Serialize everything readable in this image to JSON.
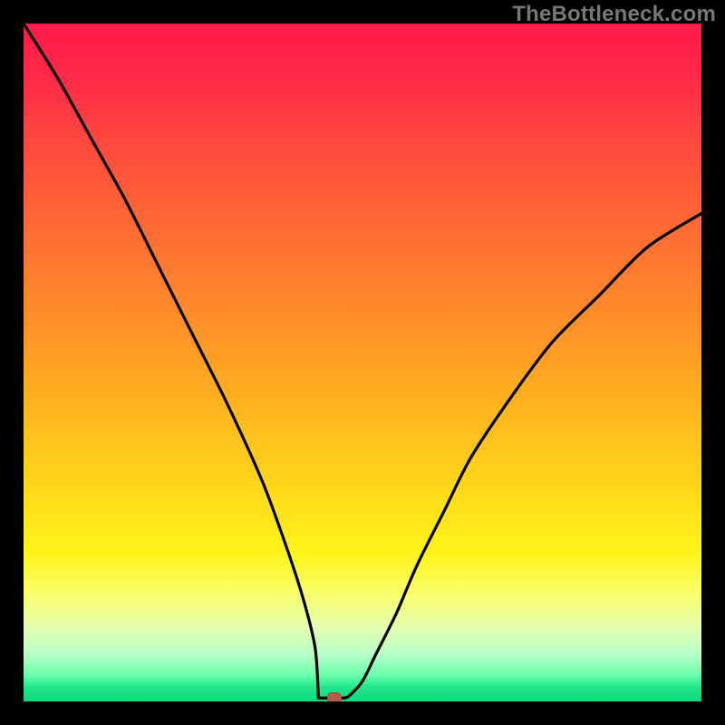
{
  "watermark": "TheBottleneck.com",
  "colors": {
    "top": "#ff1a4b",
    "bottom": "#14d47a",
    "curve": "#000000",
    "marker": "#b85a4a",
    "frame": "#000000"
  },
  "chart_data": {
    "type": "line",
    "title": "",
    "xlabel": "",
    "ylabel": "",
    "xlim": [
      0,
      100
    ],
    "ylim": [
      0,
      100
    ],
    "grid": false,
    "series": [
      {
        "name": "bottleneck-curve",
        "x": [
          0,
          5,
          10,
          15,
          20,
          25,
          30,
          35,
          38,
          41,
          43,
          44,
          45,
          46,
          48,
          50,
          52,
          55,
          58,
          62,
          66,
          72,
          78,
          85,
          92,
          100
        ],
        "y": [
          100,
          92,
          83,
          74,
          64,
          54,
          44,
          33,
          25,
          16,
          8,
          3,
          0.5,
          0.5,
          0.8,
          3,
          7,
          13,
          20,
          28,
          36,
          45,
          53,
          60,
          67,
          72
        ]
      }
    ],
    "marker": {
      "x": 45.8,
      "y": 0.5
    },
    "flat_bottom": {
      "x_start": 43.5,
      "x_end": 47.2,
      "y": 0.5
    }
  }
}
